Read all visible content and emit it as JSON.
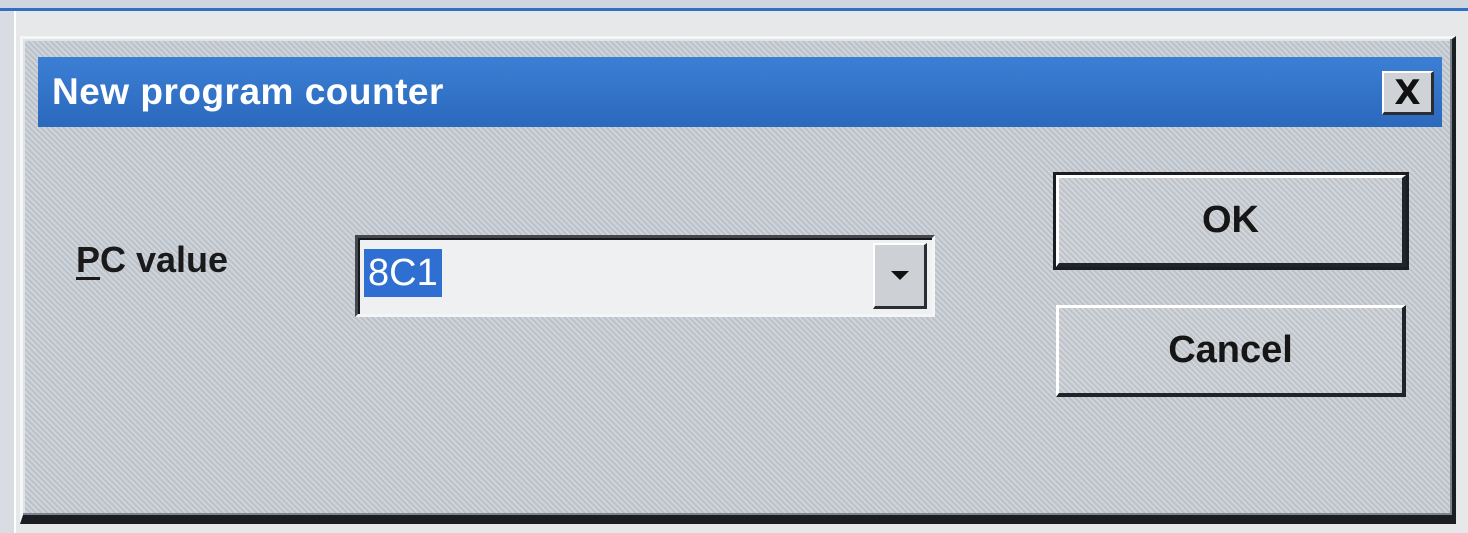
{
  "dialog": {
    "title": "New program counter",
    "close_label": "X"
  },
  "form": {
    "pc_label_mnemonic": "P",
    "pc_label_rest": "C value",
    "pc_value": "8C1"
  },
  "buttons": {
    "ok_label": "OK",
    "cancel_label": "Cancel"
  },
  "colors": {
    "titlebar": "#2f72c8",
    "selection": "#2f6fd2",
    "face": "#c6ccd3"
  },
  "icons": {
    "close": "close-icon",
    "dropdown": "chevron-down-icon"
  }
}
